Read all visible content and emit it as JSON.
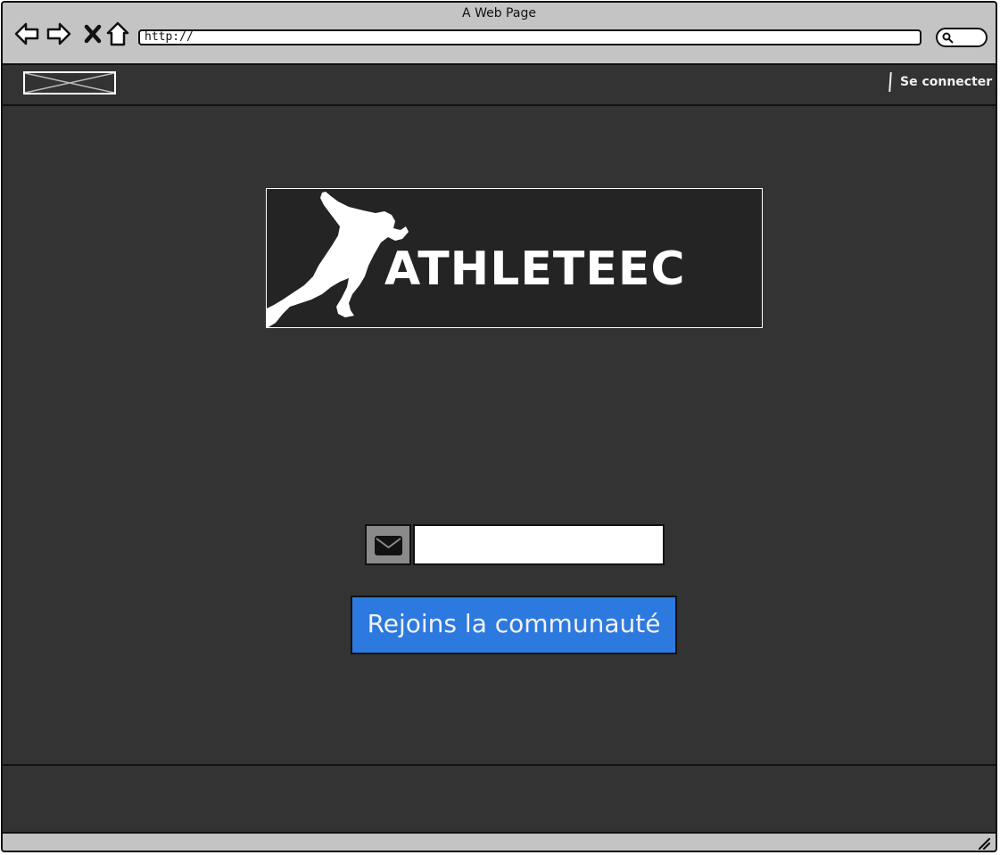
{
  "window": {
    "title": "A Web Page"
  },
  "browser": {
    "url": "http://",
    "icons": [
      "back-arrow-icon",
      "forward-arrow-icon",
      "close-x-icon",
      "home-icon",
      "search-icon"
    ]
  },
  "header": {
    "logo": "image-placeholder",
    "login_link": "Se connecter"
  },
  "main": {
    "brand_name": "ATHLETEEC",
    "email_placeholder": "",
    "email_icon": "envelope-icon",
    "join_button": "Rejoins la communauté"
  },
  "colors": {
    "chrome": "#c4c4c4",
    "background": "#333333",
    "banner": "#242424",
    "button": "#2c79df",
    "email_addon": "#8a8a8a"
  }
}
